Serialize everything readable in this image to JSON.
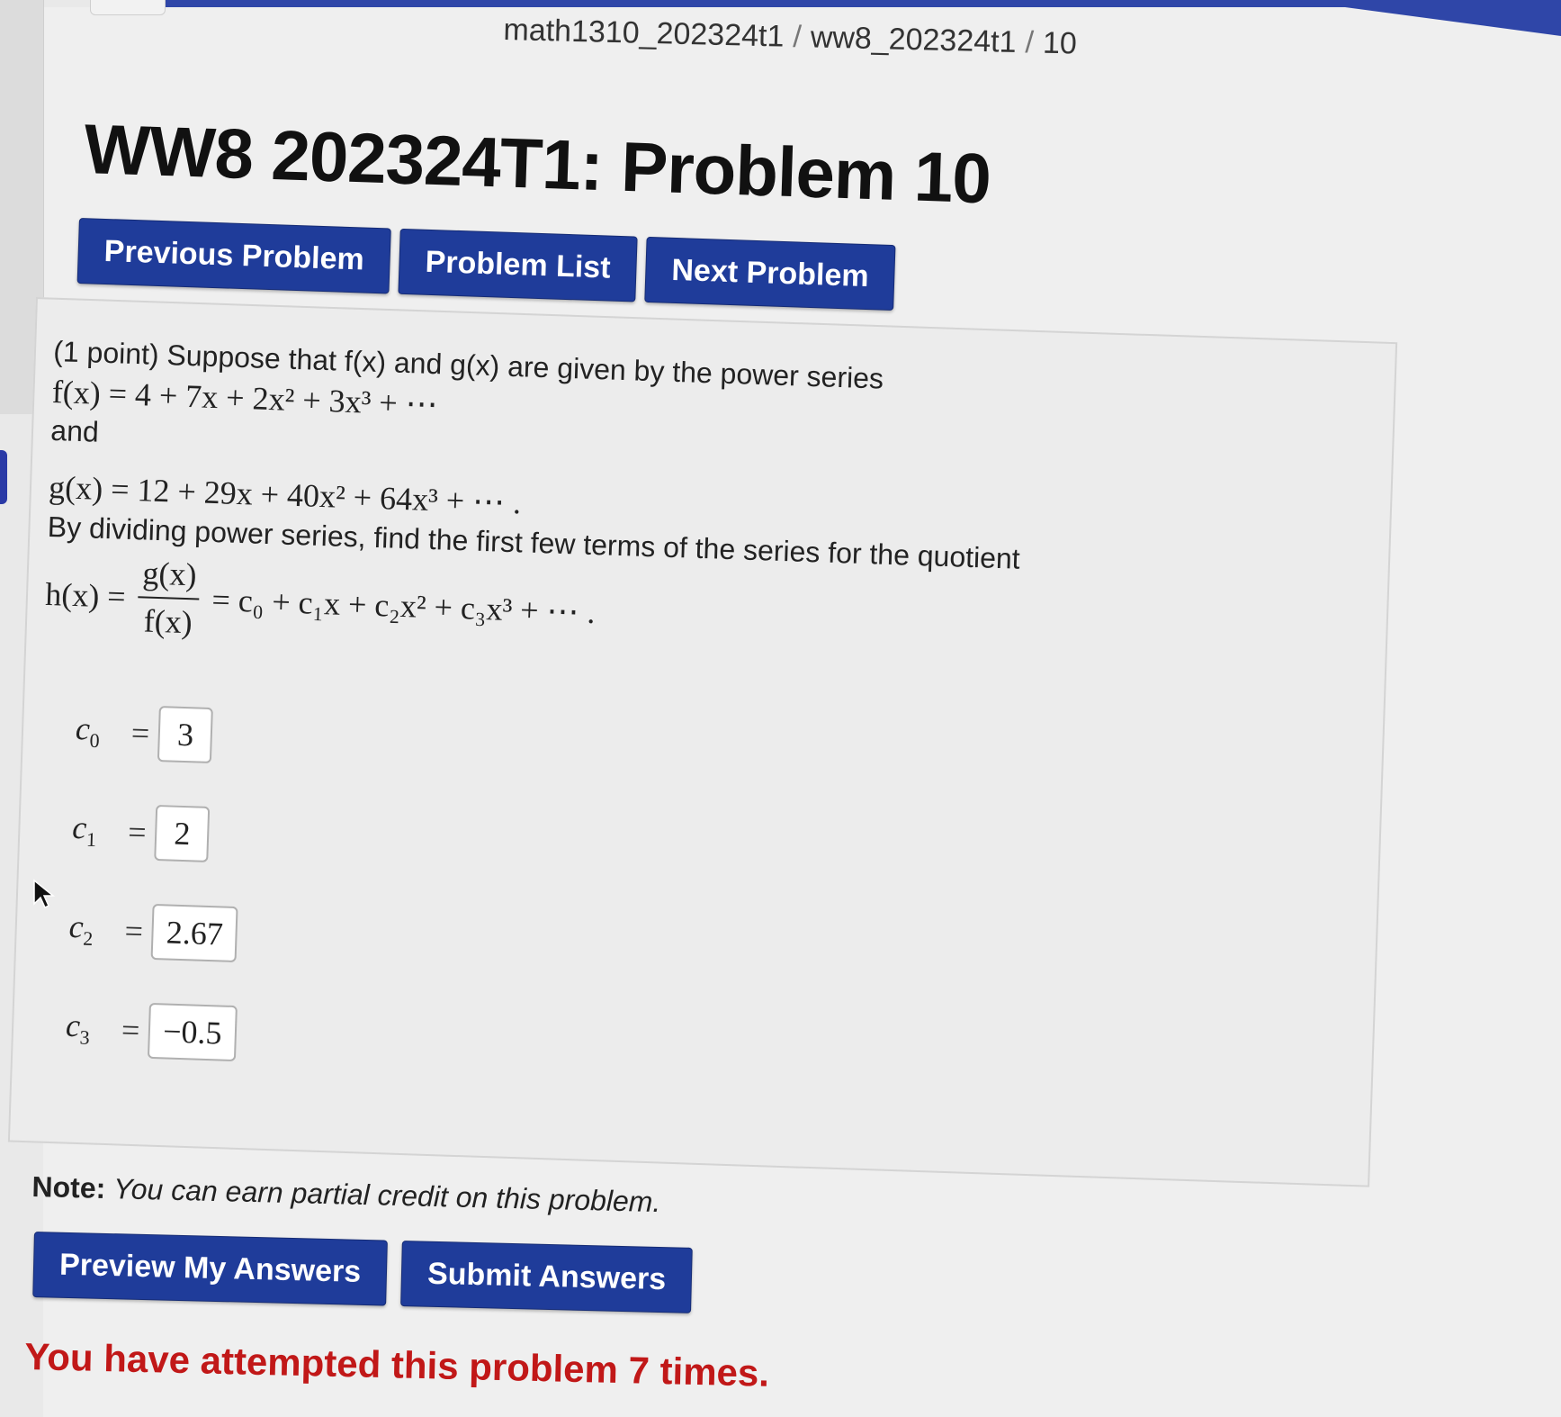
{
  "breadcrumb": {
    "course": "math1310_202324t1",
    "set": "ww8_202324t1",
    "problem": "10"
  },
  "title": "WW8 202324T1: Problem 10",
  "nav": {
    "previous": "Previous Problem",
    "list": "Problem List",
    "next": "Next Problem"
  },
  "problem": {
    "line1": "(1 point) Suppose that f(x) and g(x) are given by the power series",
    "f_series": "f(x) = 4 + 7x + 2x² + 3x³ + ⋯",
    "and": "and",
    "g_series": "g(x) = 12 + 29x + 40x² + 64x³ + ⋯ .",
    "line2": "By dividing power series, find the first few terms of the series for the quotient",
    "h_lhs": "h(x) =",
    "h_num": "g(x)",
    "h_den": "f(x)",
    "h_rhs": "= c₀ + c₁x + c₂x² + c₃x³ + ⋯ ."
  },
  "answers": [
    {
      "label": "c",
      "sub": "0",
      "value": "3"
    },
    {
      "label": "c",
      "sub": "1",
      "value": "2"
    },
    {
      "label": "c",
      "sub": "2",
      "value": "2.67"
    },
    {
      "label": "c",
      "sub": "3",
      "value": "−0.5"
    }
  ],
  "note": {
    "label": "Note:",
    "text": "You can earn partial credit on this problem."
  },
  "actions": {
    "preview": "Preview My Answers",
    "submit": "Submit Answers"
  },
  "status": {
    "attempts": "You have attempted this problem 7 times."
  },
  "colors": {
    "button": "#1f3c9a",
    "attempts": "#c11818"
  }
}
